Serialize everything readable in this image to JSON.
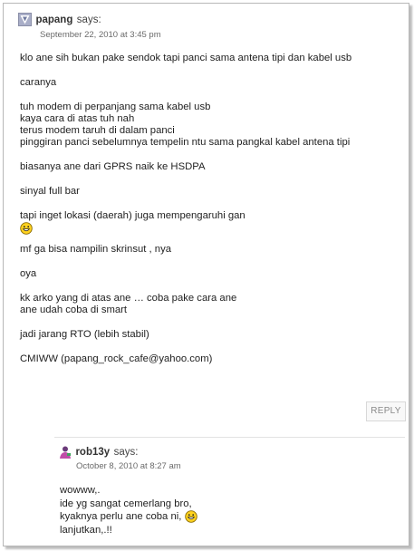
{
  "comment1": {
    "author": "papang",
    "says": "says:",
    "date": "September 22, 2010 at 3:45 pm",
    "paragraphs": [
      "klo ane sih bukan pake sendok tapi panci sama antena tipi dan kabel usb",
      "caranya",
      "tuh modem di perpanjang sama kabel usb\nkaya cara di atas tuh nah\nterus modem taruh di dalam panci\npinggiran panci sebelumnya tempelin ntu sama pangkal kabel antena tipi",
      "biasanya ane dari GPRS naik ke HSDPA",
      "sinyal full bar",
      "tapi inget lokasi (daerah) juga mempengaruhi gan",
      "mf ga bisa nampilin skrinsut , nya",
      "oya",
      "kk arko yang di atas ane … coba pake cara ane\nane udah coba di smart",
      "jadi jarang RTO (lebih stabil)",
      "CMIWW (papang_rock_cafe@yahoo.com)"
    ],
    "reply_label": "REPLY"
  },
  "comment2": {
    "author": "rob13y",
    "says": "says:",
    "date": "October 8, 2010 at 8:27 am",
    "lines": [
      "wowww,.",
      "ide yg sangat cemerlang bro,",
      "kyaknya perlu ane coba ni,",
      "lanjutkan,.!!"
    ]
  },
  "icons": {
    "avatar1": "triangle-avatar-icon",
    "avatar2": "person-avatar-icon",
    "emoticon": "grin-smiley-icon"
  }
}
